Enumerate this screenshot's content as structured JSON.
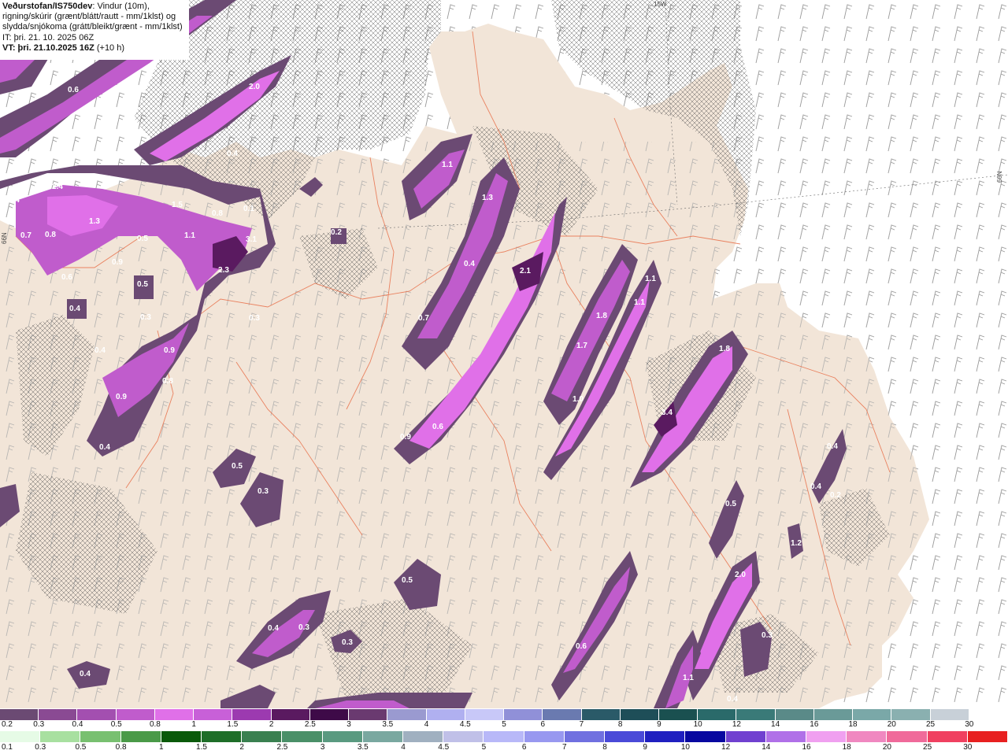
{
  "header": {
    "agency": "Veðurstofan/IS750dev",
    "title_rest": ": Vindur (10m),",
    "line2": "rigning/skúrir (grænt/blátt/rautt - mm/1klst) og",
    "line3": "slydda/snjókoma (grátt/bleikt/grænt - mm/1klst)",
    "issue_time": "IT: þri. 21. 10. 2025 06Z",
    "valid_label": "VT: þri. 21.10.2025 16Z",
    "lead": " (+10 h)"
  },
  "edge_labels": {
    "top": "15W",
    "right": "66N",
    "left": "66N"
  },
  "precip_labels": [
    "1.7",
    "0.6",
    "2.0",
    "0.4",
    "2.4",
    "0.8",
    "1.4",
    "1.5",
    "1.3",
    "0.8",
    "0.1",
    "0.7",
    "0.8",
    "3.1",
    "1.1",
    "0.5",
    "0.9",
    "2.3",
    "0.6",
    "0.5",
    "0.4",
    "0.3",
    "0.4",
    "0.9",
    "0.8",
    "0.9",
    "0.4",
    "0.3",
    "0.5",
    "0.3",
    "0.5",
    "0.4",
    "0.3",
    "0.3",
    "0.4",
    "1.1",
    "1.3",
    "0.2",
    "0.4",
    "2.1",
    "0.7",
    "0.9",
    "0.6",
    "1.1",
    "1.1",
    "1.8",
    "1.7",
    "1.0",
    "1.8",
    "3.4",
    "0.4",
    "0.4",
    "0.5",
    "1.2",
    "2.0",
    "0.6",
    "0.3",
    "1.1",
    "0.4",
    "0.2"
  ],
  "scale_snow": {
    "labels": [
      "0.2",
      "0.3",
      "0.4",
      "0.5",
      "0.8",
      "1",
      "1.5",
      "2",
      "2.5",
      "3",
      "3.5",
      "4",
      "4.5",
      "5",
      "6",
      "7",
      "8",
      "9",
      "10",
      "12",
      "14",
      "16",
      "18",
      "20",
      "25",
      "30"
    ],
    "colors": [
      "#6b4a73",
      "#8a4a93",
      "#a34fb0",
      "#c05ccc",
      "#e070e8",
      "#c860d8",
      "#9c3ab0",
      "#5a1a60",
      "#3e0a48",
      "#6a3a70",
      "#9a9ad0",
      "#b0b0f0",
      "#c8c8f8",
      "#9090d8",
      "#6a7ab0",
      "#2a5a68",
      "#1e4e58",
      "#1a5050",
      "#2a6a6a",
      "#3a7a78",
      "#5a8a88",
      "#6a9a98",
      "#7aa8a8",
      "#8ab0b0",
      "#c8d0d8",
      "#ffffff"
    ]
  },
  "scale_rain": {
    "labels": [
      "0.1",
      "0.3",
      "0.5",
      "0.8",
      "1",
      "1.5",
      "2",
      "2.5",
      "3",
      "3.5",
      "4",
      "4.5",
      "5",
      "6",
      "7",
      "8",
      "9",
      "10",
      "12",
      "14",
      "16",
      "18",
      "20",
      "25",
      "30"
    ],
    "colors": [
      "#e6fbe6",
      "#a8e0a0",
      "#78c070",
      "#4a9a48",
      "#0a5a0a",
      "#1e6e28",
      "#3a8050",
      "#4a9068",
      "#5a9a80",
      "#7aa8a0",
      "#a0b0c0",
      "#c0c0e8",
      "#b8b8f8",
      "#9898f0",
      "#7070e0",
      "#4a4ad8",
      "#2020c0",
      "#0808a0",
      "#7040d0",
      "#b070e8",
      "#f0a0f0",
      "#f088c0",
      "#f06a9a",
      "#f04060",
      "#e82020"
    ]
  },
  "colors": {
    "land": "#f2e5d8",
    "sea": "#ffffff",
    "roads": "#e8704a"
  }
}
